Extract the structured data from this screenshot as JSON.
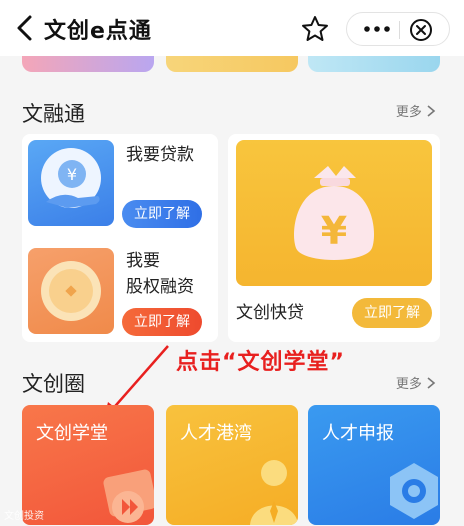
{
  "header": {
    "title": "文创e点通"
  },
  "section_finance": {
    "title": "文融通",
    "more": "更多"
  },
  "finance_items": {
    "loan": {
      "name": "我要贷款",
      "button": "立即了解"
    },
    "equity": {
      "name_line1": "我要",
      "name_line2": "股权融资",
      "button": "立即了解"
    },
    "quick": {
      "name": "文创快贷",
      "button": "立即了解"
    }
  },
  "annotation": "点击“文创学堂”",
  "section_circle": {
    "title": "文创圈",
    "more": "更多"
  },
  "circle_cards": [
    {
      "label": "文创学堂"
    },
    {
      "label": "人才港湾"
    },
    {
      "label": "人才申报"
    }
  ],
  "watermark": "文创投资",
  "colors": {
    "accent_blue": "#2f6fe6",
    "accent_orange": "#ee4a2e",
    "accent_yellow": "#f3b93a",
    "annotation_red": "#e8201f"
  }
}
